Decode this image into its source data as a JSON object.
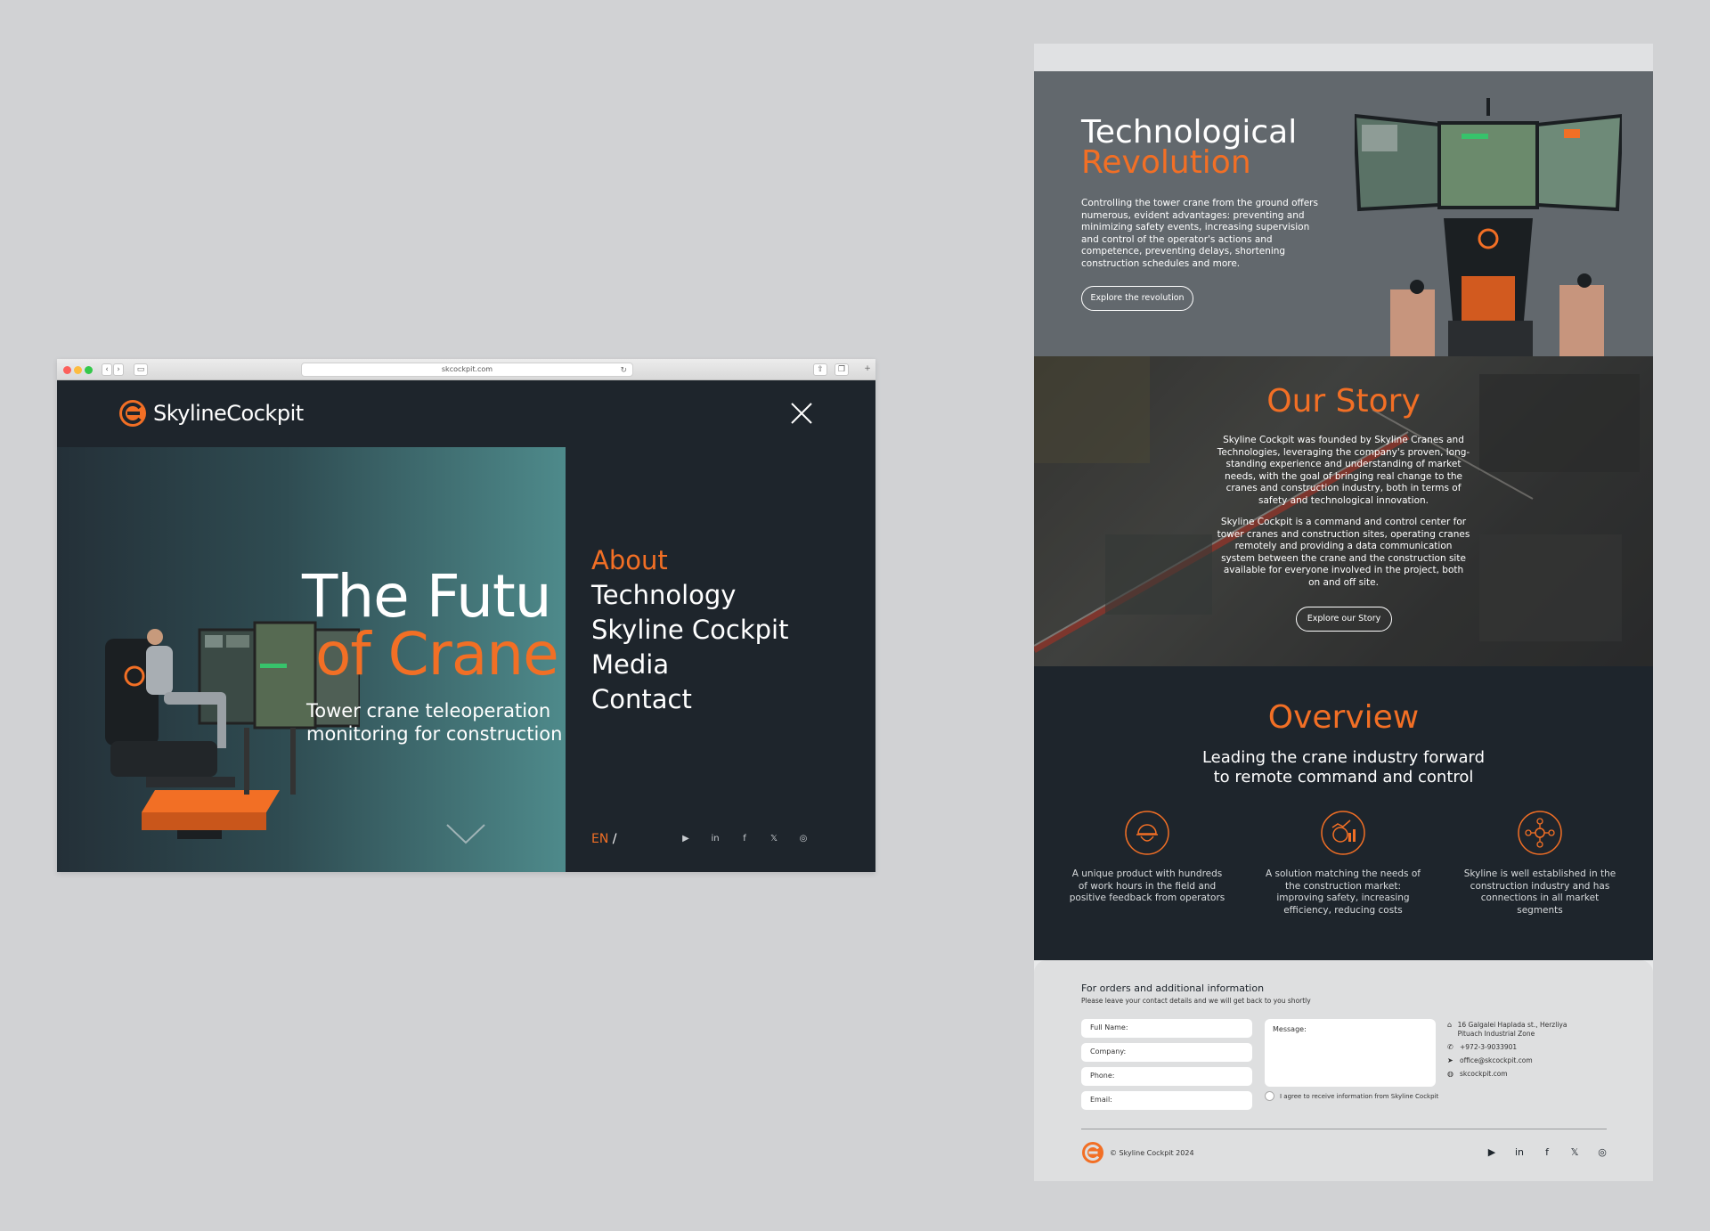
{
  "browser": {
    "url": "skcockpit.com",
    "brand": "SkylineCockpit",
    "hero": {
      "title_line1": "The Futu",
      "title_line2": "of Crane",
      "subtitle_line1": "Tower crane teleoperation",
      "subtitle_line2": "monitoring for construction"
    },
    "menu": [
      {
        "label": "About",
        "active": true
      },
      {
        "label": "Technology",
        "active": false
      },
      {
        "label": "Skyline Cockpit",
        "active": false
      },
      {
        "label": "Media",
        "active": false
      },
      {
        "label": "Contact",
        "active": false
      }
    ],
    "lang": "EN",
    "lang_sep": "/",
    "social": [
      "youtube-icon",
      "linkedin-icon",
      "facebook-icon",
      "x-icon",
      "instagram-icon"
    ]
  },
  "page": {
    "tech": {
      "title_line1": "Technological",
      "title_line2": "Revolution",
      "body": "Controlling the tower crane from the ground offers numerous, evident advantages: preventing and minimizing safety events, increasing supervision and control of the operator's actions and competence, preventing delays, shortening construction schedules and more.",
      "button": "Explore the revolution"
    },
    "story": {
      "title": "Our Story",
      "body1": "Skyline Cockpit was founded by Skyline Cranes and Technologies, leveraging the company's proven, long-standing experience and understanding of market needs, with the goal of bringing real change to the cranes and construction industry, both in terms of safety and technological innovation.",
      "body2": "Skyline Cockpit is a command and control center for tower cranes and construction sites, operating cranes remotely and providing a data communication system between the crane and the construction site available for everyone involved in the project, both on and off site.",
      "button": "Explore our Story"
    },
    "overview": {
      "title": "Overview",
      "subtitle_line1": "Leading the crane industry forward",
      "subtitle_line2": "to remote command and control",
      "features": [
        {
          "icon": "worker-helmet-icon",
          "text": "A unique product with hundreds of work hours in the field and positive feedback from operators"
        },
        {
          "icon": "market-analysis-icon",
          "text": "A solution matching the needs of the construction market: improving safety, increasing efficiency, reducing costs"
        },
        {
          "icon": "network-icon",
          "text": "Skyline is well established in the construction industry and has connections in all market segments"
        }
      ]
    },
    "form": {
      "heading": "For orders and additional information",
      "subheading": "Please leave your contact details and we will get back to you shortly",
      "fields": [
        "Full Name:",
        "Company:",
        "Phone:",
        "Email:"
      ],
      "message": "Message:",
      "agree": "I agree to receive information from Skyline Cockpit",
      "contact": {
        "address": "16 Galgalei Haplada st., Herzliya Pituach Industrial Zone",
        "phone": "+972-3-9033901",
        "email": "office@skcockpit.com",
        "web": "skcockpit.com"
      },
      "copyright": "© Skyline Cockpit 2024"
    }
  },
  "colors": {
    "accent": "#f26f25",
    "dark": "#1e252c",
    "tech_bg": "#62686d",
    "backdrop": "#d1d2d4"
  }
}
